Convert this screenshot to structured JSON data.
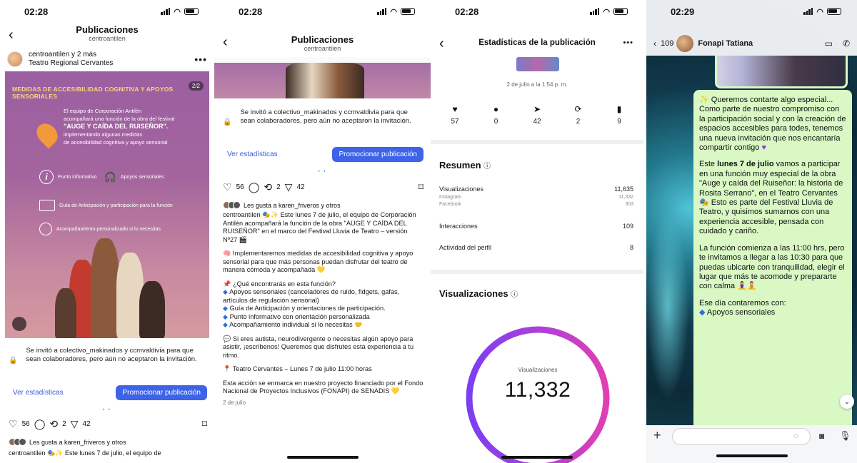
{
  "p1": {
    "time": "02:28",
    "nav_title": "Publicaciones",
    "nav_sub": "centroantilen",
    "author": "centroantilen y 2 más",
    "location": "Teatro Regional Cervantes",
    "more": "•••",
    "poster_head": "MEDIDAS DE ACCESIBILIDAD COGNITIVA Y APOYOS SENSORIALES",
    "poster_badge": "2/2",
    "poster_intro1": "El equipo de Corporación Antilén",
    "poster_intro2": "acompañará una función de la obra del festival",
    "poster_show": "\"AUGE Y CAÍDA DEL RUISEÑOR\".",
    "poster_intro3": "implementando algunas medidas",
    "poster_intro4": "de accesibilidad cognitiva y apoyo sensorial",
    "poster_item1": "Punto informativo",
    "poster_item2": "Apoyos sensoriales",
    "poster_item3": "Guía de Anticipación y participación para la función",
    "poster_item4": "Acompañamiento personalizado si lo necesitas",
    "invite_text": "Se invitó a colectivo_makinados y ccmvaldivia para que sean colaboradores, pero aún no aceptaron la invitación.",
    "stats_link": "Ver estadísticas",
    "promote": "Promocionar publicación",
    "pager": "•  •",
    "likes_count": "56",
    "reposts": "2",
    "shares": "42",
    "liked_by": "Les gusta a karen_friveros y otros",
    "caption_start": "centroantilen 🎭✨ Este lunes 7 de julio, el equipo de"
  },
  "p2": {
    "time": "02:28",
    "nav_title": "Publicaciones",
    "nav_sub": "centroantilen",
    "invite_text": "Se invitó a colectivo_makinados y ccmvaldivia para que sean colaboradores, pero aún no aceptaron la invitación.",
    "stats_link": "Ver estadísticas",
    "promote": "Promocionar publicación",
    "pager": "•  •",
    "likes_count": "56",
    "reposts": "2",
    "shares": "42",
    "liked_by": "Les gusta a karen_friveros y otros",
    "caption1": "centroantilen 🎭✨ Este lunes 7 de julio, el equipo de Corporación Antilén acompañará la función de la obra \"AUGE Y CAÍDA DEL RUISEÑOR\" en el marco del Festival Lluvia de Teatro – versión Nº27 🎬",
    "caption2": "🧠 Implementaremos medidas de accesibilidad cognitiva y apoyo sensorial para que más personas puedan disfrutar del teatro de manera cómoda y acompañada 💛",
    "caption3_title": "📌 ¿Qué encontrarás en esta función?",
    "caption3_items": [
      "Apoyos sensoriales (canceladores de ruido, fidgets, gafas, artículos de regulación sensorial)",
      "Guía de Anticipación y orientaciones de participación.",
      "Punto informativo con orientación personalizada",
      "Acompañamiento individual si lo necesitas 🤝"
    ],
    "caption4": "💬 Si eres autista, neurodivergente o necesitas algún apoyo para asistir, ¡escríbenos! Queremos que disfrutes esta experiencia a tu ritmo.",
    "caption5": "📍 Teatro Cervantes – Lunes 7 de julio 11:00 horas",
    "caption6": "Esta acción se enmarca en nuestro proyecto financiado por el Fondo Nacional de Proyectos Inclusivos (FONAPI) de SENADIS 💛",
    "date": "2 de julio"
  },
  "p3": {
    "time": "02:28",
    "nav_title": "Estadísticas de la publicación",
    "more": "•••",
    "date": "2 de julio a la 1:54 p. m.",
    "metrics": [
      {
        "icon": "heart-icon",
        "glyph": "♥",
        "value": "57"
      },
      {
        "icon": "comment-icon",
        "glyph": "●",
        "value": "0"
      },
      {
        "icon": "share-icon",
        "glyph": "➤",
        "value": "42"
      },
      {
        "icon": "repost-icon",
        "glyph": "⟳",
        "value": "2"
      },
      {
        "icon": "bookmark-icon",
        "glyph": "▮",
        "value": "9"
      }
    ],
    "summary_title": "Resumen",
    "views_label": "Visualizaciones",
    "views_value": "11,635",
    "instagram_label": "Instagram",
    "instagram_value": "11,332",
    "facebook_label": "Facebook",
    "facebook_value": "303",
    "interactions_label": "Interacciones",
    "interactions_value": "109",
    "profile_label": "Actividad del perfil",
    "profile_value": "8",
    "vis_title": "Visualizaciones",
    "donut_label": "Visualizaciones",
    "donut_value": "11,332",
    "donut_colors": [
      "#7b3ff2",
      "#b13fd9",
      "#e03fb2"
    ]
  },
  "p4": {
    "time": "02:29",
    "back_count": "109",
    "contact": "Fonapi Tatiana",
    "bubble_p1": "✨ Queremos contarte algo especial... Como parte de nuestro compromiso con la participación social y con la creación de espacios accesibles para todes, tenemos una nueva invitación que nos encantaría compartir contigo",
    "bubble_p2_pre": "Este ",
    "bubble_p2_bold": "lunes 7 de julio",
    "bubble_p2_post": " vamos a participar en una función muy especial de la obra \"Auge y caída del Ruiseñor: la historia de Rosita Serrano\", en el Teatro Cervantes 🎭 Esto es parte del Festival Lluvia de Teatro, y quisimos sumarnos con una experiencia accesible, pensada con cuidado y cariño.",
    "bubble_p3": "La función comienza a las 11:00 hrs, pero te invitamos a llegar a las 10:30 para que puedas ubicarte con tranquilidad, elegir el lugar que más te acomode y prepararte con calma 🧘‍♀️🧘",
    "bubble_p4": "Ese día contaremos con:",
    "bubble_p5": "Apoyos sensoriales"
  }
}
